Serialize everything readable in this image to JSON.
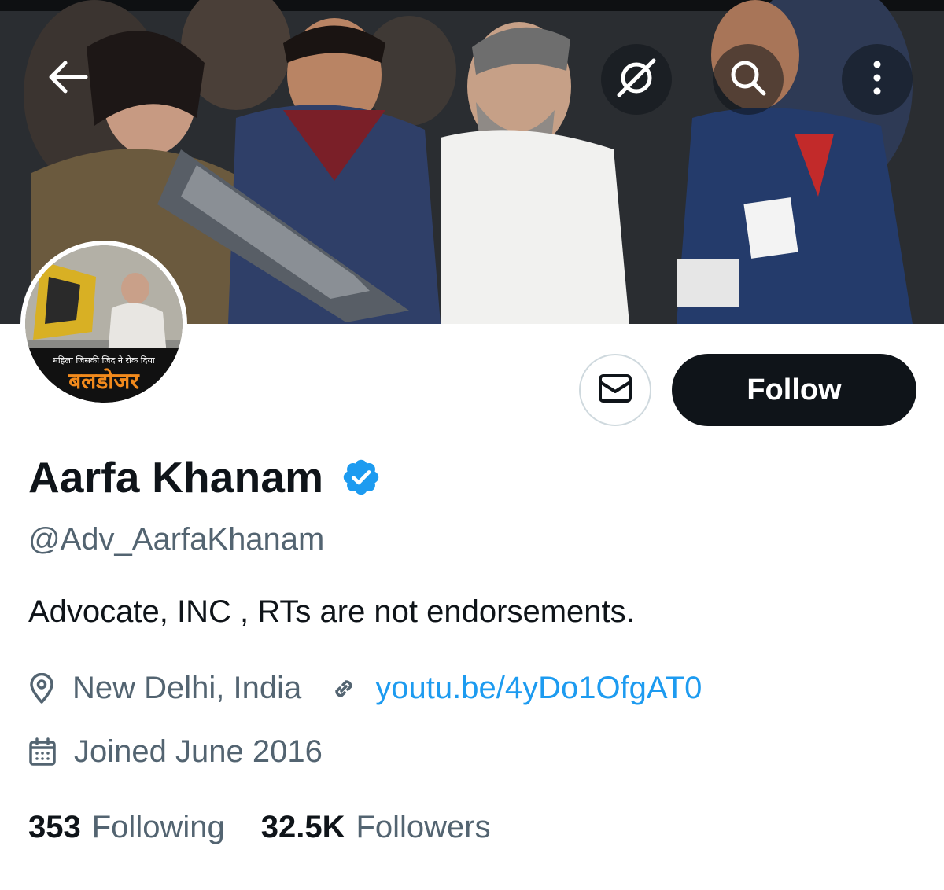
{
  "colors": {
    "text_primary": "#0f1419",
    "text_secondary": "#536471",
    "link": "#1d9bf0",
    "verified_badge": "#1d9bf0",
    "follow_button_bg": "#0f1419"
  },
  "header": {
    "back_icon": "arrow-left-icon",
    "grok_icon": "grok-slash-circle-icon",
    "search_icon": "search-icon",
    "more_icon": "more-vertical-icon"
  },
  "avatar": {
    "overlay_text_top": "महिला जिसकी   जिद ने रोक दिया",
    "overlay_text_main": "बलडोजर"
  },
  "actions": {
    "message_icon": "envelope-icon",
    "follow_label": "Follow"
  },
  "profile": {
    "display_name": "Aarfa Khanam",
    "verified_icon": "verified-badge-icon",
    "handle": "@Adv_AarfaKhanam",
    "bio": "Advocate, INC , RTs are not endorsements.",
    "location": "New Delhi, India",
    "location_icon": "location-pin-icon",
    "website": "youtu.be/4yDo1OfgAT0",
    "website_icon": "link-icon",
    "joined": "Joined June 2016",
    "joined_icon": "calendar-icon"
  },
  "stats": {
    "following_count": "353",
    "following_label": "Following",
    "followers_count": "32.5K",
    "followers_label": "Followers"
  }
}
